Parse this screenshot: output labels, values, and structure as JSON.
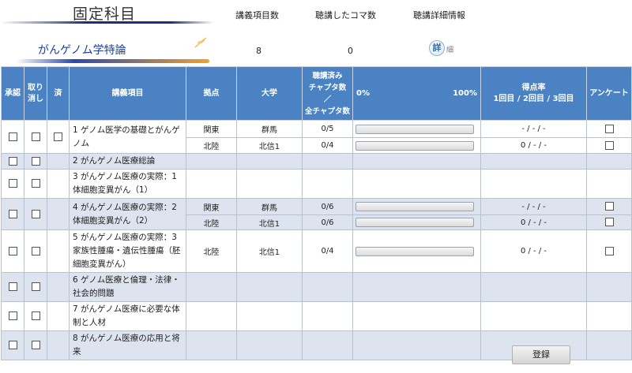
{
  "header": {
    "title": "固定科目",
    "col_count_label": "講義項目数",
    "col_attended_label": "聴講したコマ数",
    "col_detail_label": "聴講詳細情報"
  },
  "course": {
    "name": "がんゲノム学特論",
    "item_count": "8",
    "attended_count": "0",
    "detail_icon_text": "詳",
    "detail_text": "細"
  },
  "table": {
    "headers": {
      "approve": "承認",
      "cancel": "取り消し",
      "done": "済",
      "item": "講義項目",
      "site": "拠点",
      "university": "大学",
      "chapters_1": "聴講済み",
      "chapters_2": "チャプタ数",
      "chapters_3": "／",
      "chapters_4": "全チャプタ数",
      "pct_0": "0%",
      "pct_100": "100%",
      "score_1": "得点率",
      "score_2": "1回目 / 2回目 / 3回目",
      "survey": "アンケート"
    },
    "items": [
      {
        "label": "1 ゲノム医学の基礎とがんゲノム",
        "done_checkbox": true,
        "lines": [
          {
            "site": "関東",
            "univ": "群馬",
            "chapters": "0/5",
            "progress": 0,
            "score": "- / - / -",
            "survey": true
          },
          {
            "site": "北陸",
            "univ": "北信1",
            "chapters": "0/4",
            "progress": 0,
            "score": "0 / - / -",
            "survey": true
          }
        ]
      },
      {
        "label": "2 がんゲノム医療総論",
        "done_checkbox": false,
        "lines": []
      },
      {
        "label": "3 がんゲノム医療の実際：1　体細胞変異がん（1）",
        "done_checkbox": false,
        "lines": []
      },
      {
        "label": "4 がんゲノム医療の実際：2　体細胞変異がん（2）",
        "done_checkbox": false,
        "lines": [
          {
            "site": "関東",
            "univ": "群馬",
            "chapters": "0/6",
            "progress": 0,
            "score": "- / - / -",
            "survey": true
          },
          {
            "site": "北陸",
            "univ": "北信1",
            "chapters": "0/6",
            "progress": 0,
            "score": "0 / - / -",
            "survey": true
          }
        ]
      },
      {
        "label": "5 がんゲノム医療の実際：3　家族性腫瘍・遺伝性腫瘍（胚細胞変異がん）",
        "done_checkbox": false,
        "lines": [
          {
            "site": "北陸",
            "univ": "北信1",
            "chapters": "0/4",
            "progress": 0,
            "score": "0 / - / -",
            "survey": true
          }
        ]
      },
      {
        "label": "6 ゲノム医療と倫理・法律・社会的問題",
        "done_checkbox": false,
        "lines": []
      },
      {
        "label": "7 がんゲノム医療に必要な体制と人材",
        "done_checkbox": false,
        "lines": []
      },
      {
        "label": "8 がんゲノム医療の応用と将来",
        "done_checkbox": false,
        "lines": []
      }
    ]
  },
  "footer": {
    "register_label": "登録"
  }
}
